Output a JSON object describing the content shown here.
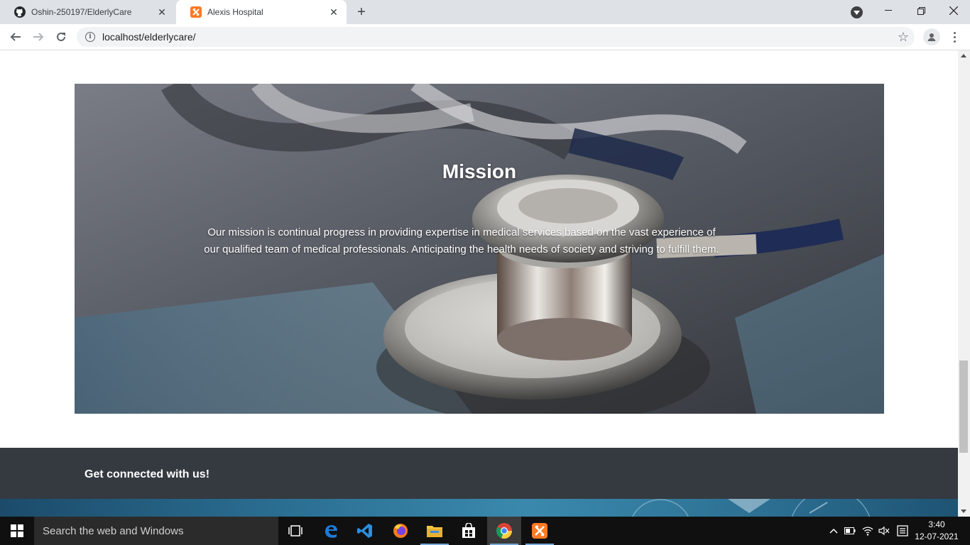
{
  "browser": {
    "tabs": [
      {
        "title": "Oshin-250197/ElderlyCare",
        "icon": "github-icon",
        "active": false
      },
      {
        "title": "Alexis Hospital",
        "icon": "xampp-icon",
        "active": true
      }
    ],
    "url": "localhost/elderlycare/"
  },
  "page": {
    "mission": {
      "title": "Mission",
      "text": "Our mission is continual progress in providing expertise in medical services based on the vast experience of our qualified team of medical professionals. Anticipating the health needs of society and striving to fulfill them."
    },
    "footer": {
      "heading": "Get connected with us!"
    }
  },
  "taskbar": {
    "search_placeholder": "Search the web and Windows",
    "apps": [
      "task-view-icon",
      "edge-icon",
      "vscode-icon",
      "firefox-icon",
      "file-explorer-icon",
      "store-icon",
      "chrome-icon",
      "xampp-icon"
    ],
    "time": "3:40",
    "date": "12-07-2021"
  },
  "colors": {
    "footer_bg": "#343a40",
    "tabstrip_bg": "#dee1e6",
    "taskbar_bg": "#101010",
    "xampp_orange": "#fb7a24"
  }
}
